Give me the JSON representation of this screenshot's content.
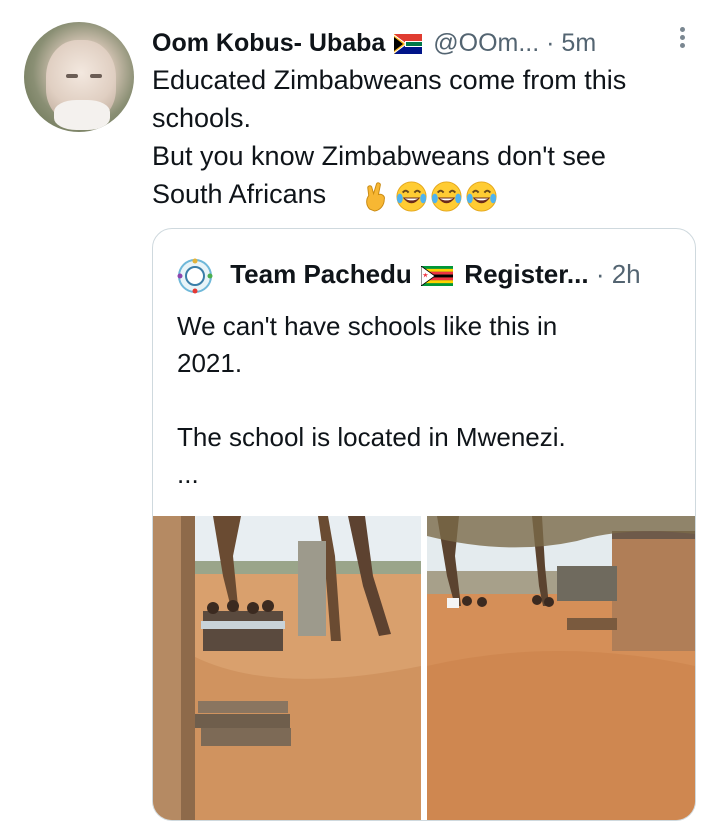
{
  "tweet": {
    "author_name": "Oom Kobus- Ubaba",
    "handle": "@OOm...",
    "time": "· 5m",
    "text": "Educated Zimbabweans come from this\nschools.\nBut you know Zimbabweans don't see\nSouth Africans",
    "emojis": [
      "crossed-fingers",
      "tears-of-joy",
      "tears-of-joy",
      "tears-of-joy"
    ]
  },
  "quote": {
    "author_name": "Team Pachedu",
    "name_suffix": "Register...",
    "time": "· 2h",
    "text": "We can't have schools like this in\n2021.\n\nThe school is located in Mwenezi.\n..."
  },
  "colors": {
    "text": "#0f1419",
    "secondary": "#536471",
    "border": "#cfd9de"
  }
}
